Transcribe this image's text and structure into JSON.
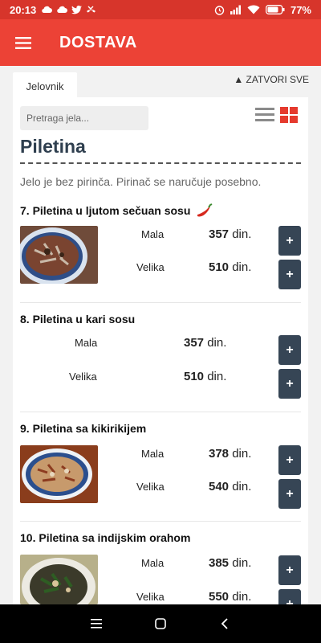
{
  "statusbar": {
    "time": "20:13",
    "battery": "77%"
  },
  "appbar": {
    "title": "DOSTAVA"
  },
  "tabs": {
    "active": "Jelovnik",
    "close_all": "▲ ZATVORI SVE"
  },
  "search": {
    "placeholder": "Pretraga jela..."
  },
  "category": {
    "title": "Piletina",
    "note": "Jelo je bez pirinča. Pirinač se naručuje posebno."
  },
  "items": [
    {
      "name": "7. Piletina u ljutom sečuan sosu",
      "spicy": true,
      "sizes": [
        {
          "label": "Mala",
          "price": "357",
          "currency": "din."
        },
        {
          "label": "Velika",
          "price": "510",
          "currency": "din."
        }
      ]
    },
    {
      "name": "8. Piletina u kari sosu",
      "sizes": [
        {
          "label": "Mala",
          "price": "357",
          "currency": "din."
        },
        {
          "label": "Velika",
          "price": "510",
          "currency": "din."
        }
      ]
    },
    {
      "name": "9. Piletina sa kikirikijem",
      "sizes": [
        {
          "label": "Mala",
          "price": "378",
          "currency": "din."
        },
        {
          "label": "Velika",
          "price": "540",
          "currency": "din."
        }
      ]
    },
    {
      "name": "10. Piletina sa indijskim orahom",
      "sizes": [
        {
          "label": "Mala",
          "price": "385",
          "currency": "din."
        },
        {
          "label": "Velika",
          "price": "550",
          "currency": "din."
        }
      ]
    }
  ],
  "add_label": "+",
  "colors": {
    "appbar": "#ec4236",
    "statusbar": "#d7352b",
    "button": "#364555",
    "title": "#2f3f4f"
  }
}
